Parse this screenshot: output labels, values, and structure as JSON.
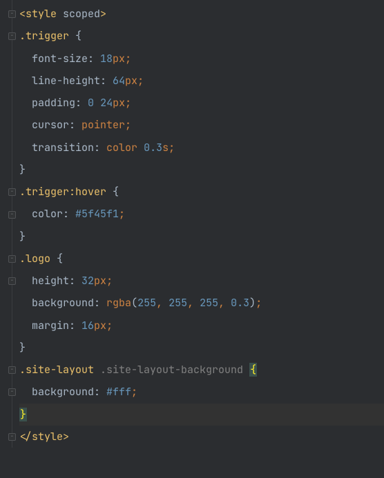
{
  "code": {
    "l1": {
      "open": "<",
      "tag": "style",
      "attr": " scoped",
      "close": ">"
    },
    "l2": {
      "sel": ".trigger",
      "brace": " {"
    },
    "l3": {
      "prop": "  font-size",
      "colon": ": ",
      "num": "18",
      "unit": "px",
      "semi": ";"
    },
    "l4": {
      "prop": "  line-height",
      "colon": ": ",
      "num": "64",
      "unit": "px",
      "semi": ";"
    },
    "l5": {
      "prop": "  padding",
      "colon": ": ",
      "num1": "0",
      "sp": " ",
      "num2": "24",
      "unit": "px",
      "semi": ";"
    },
    "l6": {
      "prop": "  cursor",
      "colon": ": ",
      "val": "pointer",
      "semi": ";"
    },
    "l7": {
      "prop": "  transition",
      "colon": ": ",
      "val": "color",
      "sp": " ",
      "num": "0.3",
      "unit": "s",
      "semi": ";"
    },
    "l8": {
      "brace": "}"
    },
    "l9": {
      "sel": ".trigger",
      "pseudo": ":hover",
      "brace": " {"
    },
    "l10": {
      "prop": "  color",
      "colon": ": ",
      "val": "#5f45f1",
      "semi": ";"
    },
    "l11": {
      "brace": "}"
    },
    "l12": {
      "sel": ".logo",
      "brace": " {"
    },
    "l13": {
      "prop": "  height",
      "colon": ": ",
      "num": "32",
      "unit": "px",
      "semi": ";"
    },
    "l14": {
      "prop": "  background",
      "colon": ": ",
      "fn": "rgba",
      "lp": "(",
      "a1": "255",
      "c1": ", ",
      "a2": "255",
      "c2": ", ",
      "a3": "255",
      "c3": ", ",
      "a4": "0.3",
      "rp": ")",
      "semi": ";"
    },
    "l15": {
      "prop": "  margin",
      "colon": ": ",
      "num": "16",
      "unit": "px",
      "semi": ";"
    },
    "l16": {
      "brace": "}"
    },
    "l17": {
      "sel1": ".site-layout",
      "sp": " ",
      "sel2": ".site-layout-background",
      "sp2": " ",
      "brace": "{"
    },
    "l18": {
      "prop": "  background",
      "colon": ": ",
      "val": "#fff",
      "semi": ";"
    },
    "l19": {
      "brace": "}"
    },
    "l20": {
      "open": "</",
      "tag": "style",
      "close": ">"
    }
  }
}
